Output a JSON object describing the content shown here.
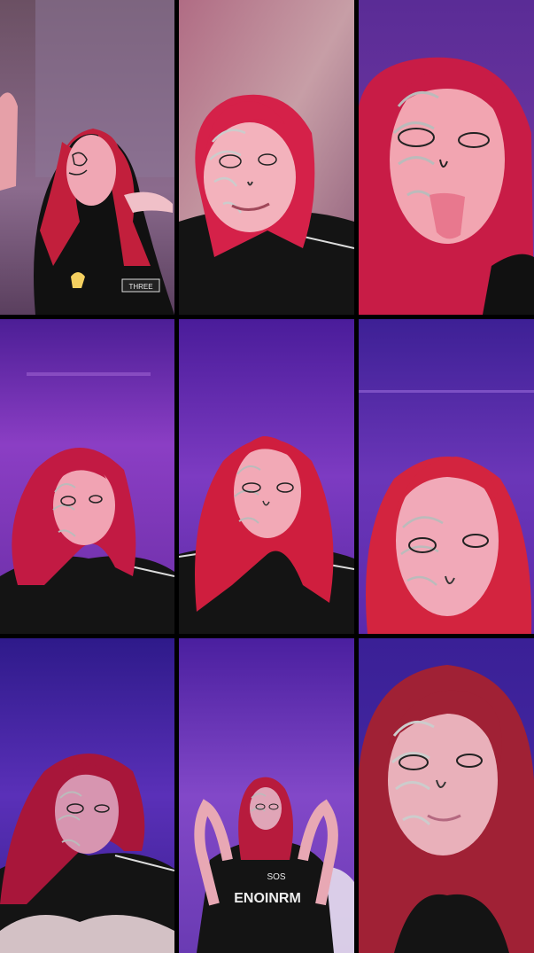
{
  "collage": {
    "rows": 3,
    "columns": 3,
    "tiles": [
      {
        "id": "r1c1",
        "background": "#7a5a7d",
        "hair": "#c21f3c",
        "skin": "#f0a7b4",
        "shirt_text": "THREE"
      },
      {
        "id": "r1c2",
        "background": "#a56e83",
        "hair": "#d52149",
        "skin": "#f3b2bc",
        "shirt_text": ""
      },
      {
        "id": "r1c3",
        "background": "#6d2d9e",
        "hair": "#c81c46",
        "skin": "#f2a5b1",
        "shirt_text": ""
      },
      {
        "id": "r2c1",
        "background": "#6a24a6",
        "hair": "#c21a43",
        "skin": "#f1a3b3",
        "shirt_text": ""
      },
      {
        "id": "r2c2",
        "background": "#5c22a8",
        "hair": "#cf1e3e",
        "skin": "#f2a9b6",
        "shirt_text": ""
      },
      {
        "id": "r2c3",
        "background": "#5c2ab0",
        "hair": "#d3243f",
        "skin": "#f1a9b8",
        "shirt_text": ""
      },
      {
        "id": "r3c1",
        "background": "#3c1f9c",
        "hair": "#a8163a",
        "skin": "#d795b0",
        "shirt_text": ""
      },
      {
        "id": "r3c2",
        "background": "#5a2ab7",
        "hair": "#b71b3d",
        "skin": "#e0a5b7",
        "shirt_text": "ENOINRM"
      },
      {
        "id": "r3c3",
        "background": "#4a2aa9",
        "hair": "#a02135",
        "skin": "#e9b0ba",
        "shirt_text": ""
      }
    ]
  }
}
